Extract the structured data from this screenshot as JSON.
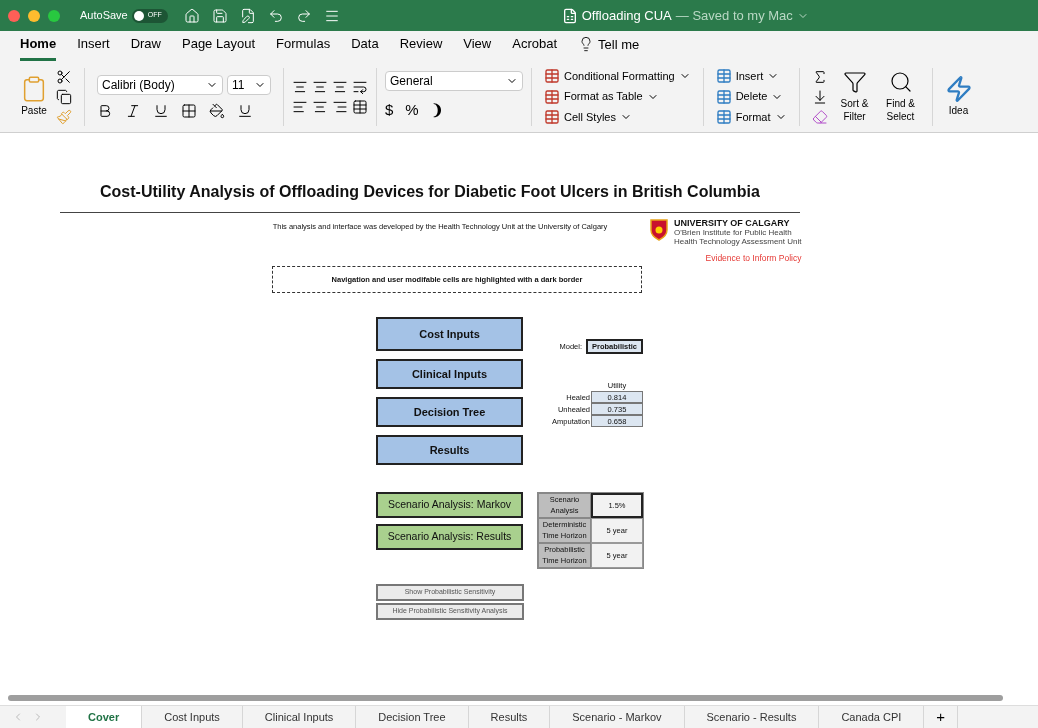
{
  "title_bar": {
    "autosave_label": "AutoSave",
    "autosave_on": false,
    "autosave_state": "OFF",
    "document_title": "Offloading CUA",
    "save_status": "— Saved to my Mac"
  },
  "ribbon_tabs": [
    {
      "label": "Home",
      "selected": true
    },
    {
      "label": "Insert",
      "selected": false
    },
    {
      "label": "Draw",
      "selected": false
    },
    {
      "label": "Page Layout",
      "selected": false
    },
    {
      "label": "Formulas",
      "selected": false
    },
    {
      "label": "Data",
      "selected": false
    },
    {
      "label": "Review",
      "selected": false
    },
    {
      "label": "View",
      "selected": false
    },
    {
      "label": "Acrobat",
      "selected": false
    }
  ],
  "tell_me": "Tell me",
  "ribbon": {
    "paste": "Paste",
    "font_name": "Calibri (Body)",
    "font_size": "11",
    "number_format": "General",
    "currency": "$",
    "percent": "%",
    "comma": "❩",
    "styles": [
      "Conditional Formatting",
      "Format as Table",
      "Cell Styles"
    ],
    "cells": [
      "Insert",
      "Delete",
      "Format"
    ],
    "sort": "Sort & Filter",
    "find": "Find & Select",
    "ideas": "Idea"
  },
  "sheet": {
    "title": "Cost-Utility Analysis of Offloading Devices for Diabetic Foot Ulcers in British Columbia",
    "credit": "This analysis and interface was developed by the Health Technology Unit at the University of Calgary",
    "university": {
      "name": "UNIVERSITY OF CALGARY",
      "line1": "O'Brien Institute for Public Health",
      "line2": "Health Technology Assessment Unit",
      "tagline": "Evidence to Inform Policy"
    },
    "note": "Navigation and user modifable cells are highlighted with a dark border",
    "nav_buttons": [
      {
        "label": "Cost Inputs",
        "kind": "blue"
      },
      {
        "label": "Clinical Inputs",
        "kind": "blue"
      },
      {
        "label": "Decision Tree",
        "kind": "blue"
      },
      {
        "label": "Results",
        "kind": "blue"
      }
    ],
    "model": {
      "label": "Model:",
      "value": "Probabilistic"
    },
    "utility": {
      "header": "Utility",
      "rows": [
        {
          "label": "Healed",
          "value": "0.814"
        },
        {
          "label": "Unhealed",
          "value": "0.735"
        },
        {
          "label": "Amputation",
          "value": "0.658"
        }
      ]
    },
    "scenario_buttons": [
      {
        "label": "Scenario Analysis: Markov",
        "kind": "green"
      },
      {
        "label": "Scenario Analysis: Results",
        "kind": "green"
      }
    ],
    "scenario_table": [
      {
        "label": "Scenario Analysis",
        "value": "1.5%",
        "editable": true
      },
      {
        "label": "Deterministic Time Horizon",
        "value": "5 year",
        "editable": false
      },
      {
        "label": "Probabilistic Time Horizon",
        "value": "5 year",
        "editable": false
      }
    ],
    "sensitivity_buttons": [
      "Show Probabilistic Sensitivity",
      "Hide Probabilistic Sensitivity Analysis"
    ]
  },
  "sheet_tabs": [
    {
      "label": "Cover",
      "selected": true
    },
    {
      "label": "Cost Inputs",
      "selected": false
    },
    {
      "label": "Clinical Inputs",
      "selected": false
    },
    {
      "label": "Decision Tree",
      "selected": false
    },
    {
      "label": "Results",
      "selected": false
    },
    {
      "label": "Scenario - Markov",
      "selected": false
    },
    {
      "label": "Scenario - Results",
      "selected": false
    },
    {
      "label": "Canada CPI",
      "selected": false
    }
  ],
  "add_tab": "+"
}
